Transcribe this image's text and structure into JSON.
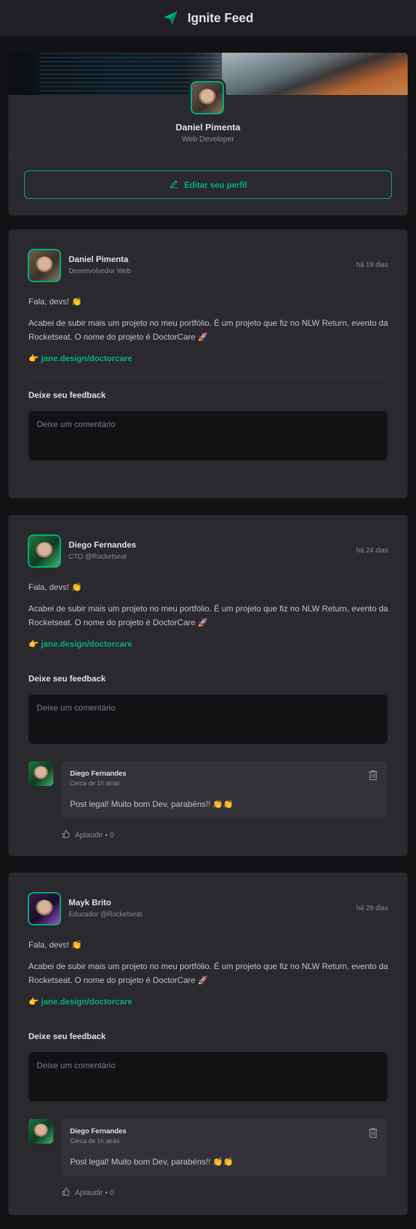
{
  "header": {
    "title": "Ignite Feed",
    "logo_icon": "paper-plane-icon"
  },
  "profile": {
    "name": "Daniel Pimenta",
    "role": "Web Developer",
    "edit_label": "Editar seu perfil",
    "edit_icon": "pencil-icon"
  },
  "posts": [
    {
      "author": "Daniel Pimenta",
      "role": "Desenvolvedor Web",
      "time": "há 19 dias",
      "greeting": "Fala, devs! 👏",
      "body": "Acabei de subir mais um projeto no meu portfólio. É um projeto que fiz no NLW Return, evento da Rocketseat. O nome do projeto é DoctorCare 🚀",
      "link_prefix": "👉",
      "link": "jane.design/doctorcare",
      "feedback_title": "Deixe seu feedback",
      "comment_placeholder": "Deixe um comentário",
      "comments": []
    },
    {
      "author": "Diego Fernandes",
      "role": "CTO @Rocketseat",
      "time": "há 24 dias",
      "greeting": "Fala, devs! 👏",
      "body": "Acabei de subir mais um projeto no meu portfólio. É um projeto que fiz no NLW Return, evento da Rocketseat. O nome do projeto é DoctorCare 🚀",
      "link_prefix": "👉",
      "link": "jane.design/doctorcare",
      "feedback_title": "Deixe seu feedback",
      "comment_placeholder": "Deixe um comentário",
      "comments": [
        {
          "author": "Diego Fernandes",
          "time": "Cerca de 1h atrás",
          "text": "Post legal! Muito bom Dev, parabéns!! 👏👏",
          "applaud": "Aplaudir • 0"
        }
      ]
    },
    {
      "author": "Mayk Brito",
      "role": "Educador @Rocketseat",
      "time": "há 29 dias",
      "greeting": "Fala, devs! 👏",
      "body": "Acabei de subir mais um projeto no meu portfólio. É um projeto que fiz no NLW Return, evento da Rocketseat. O nome do projeto é DoctorCare 🚀",
      "link_prefix": "👉",
      "link": "jane.design/doctorcare",
      "feedback_title": "Deixe seu feedback",
      "comment_placeholder": "Deixe um comentário",
      "comments": [
        {
          "author": "Diego Fernandes",
          "time": "Cerca de 1h atrás",
          "text": "Post legal! Muito bom Dev, parabéns!! 👏👏",
          "applaud": "Aplaudir • 0"
        }
      ]
    }
  ],
  "colors": {
    "accent": "#00b37e",
    "background": "#121214",
    "card": "#29292e"
  }
}
